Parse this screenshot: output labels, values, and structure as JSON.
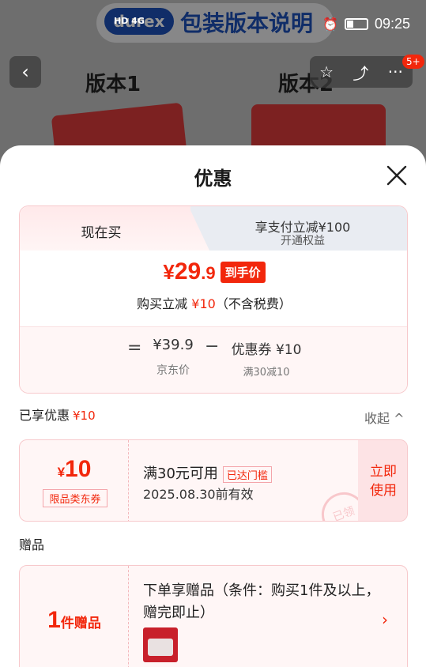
{
  "background": {
    "banner_logo": "durex",
    "banner_title": "包装版本说明",
    "version_1": "版本1",
    "version_2": "版本2"
  },
  "status_bar": {
    "network": "HD 4G",
    "time": "09:25"
  },
  "nav": {
    "back_icon": "chevron-left-icon",
    "badge": "5+"
  },
  "sheet": {
    "title": "优惠"
  },
  "price_card": {
    "tab_now": "现在买",
    "tab_pay_title": "享支付立减¥100",
    "tab_pay_sub": "开通权益",
    "price_yen": "¥",
    "price_int": "29",
    "price_dec": ".9",
    "price_tag": "到手价",
    "sub_prefix": "购买立减",
    "sub_amount": "¥10",
    "sub_suffix": "（不含税费）",
    "eq": "=",
    "jd_price": "¥39.9",
    "jd_label": "京东价",
    "minus": "−",
    "coupon_value": "优惠券 ¥10",
    "coupon_rule": "满30减10"
  },
  "summary": {
    "label": "已享优惠",
    "amount": "¥10",
    "collapse": "收起 ^"
  },
  "coupon": {
    "yen": "¥",
    "amount": "10",
    "type": "限品类东券",
    "condition": "满30元可用",
    "reached": "已达门槛",
    "valid": "2025.08.30前有效",
    "use_line1": "立即",
    "use_line2": "使用",
    "stamp": "已领"
  },
  "gift": {
    "section_title": "赠品",
    "count": "1",
    "count_unit": "件赠品",
    "description": "下单享赠品（条件：购买1件及以上，赠完即止）",
    "arrow": "›"
  },
  "colors": {
    "accent": "#f2270c",
    "card_border": "#f7c9cc",
    "card_bg": "#fff6f6"
  }
}
